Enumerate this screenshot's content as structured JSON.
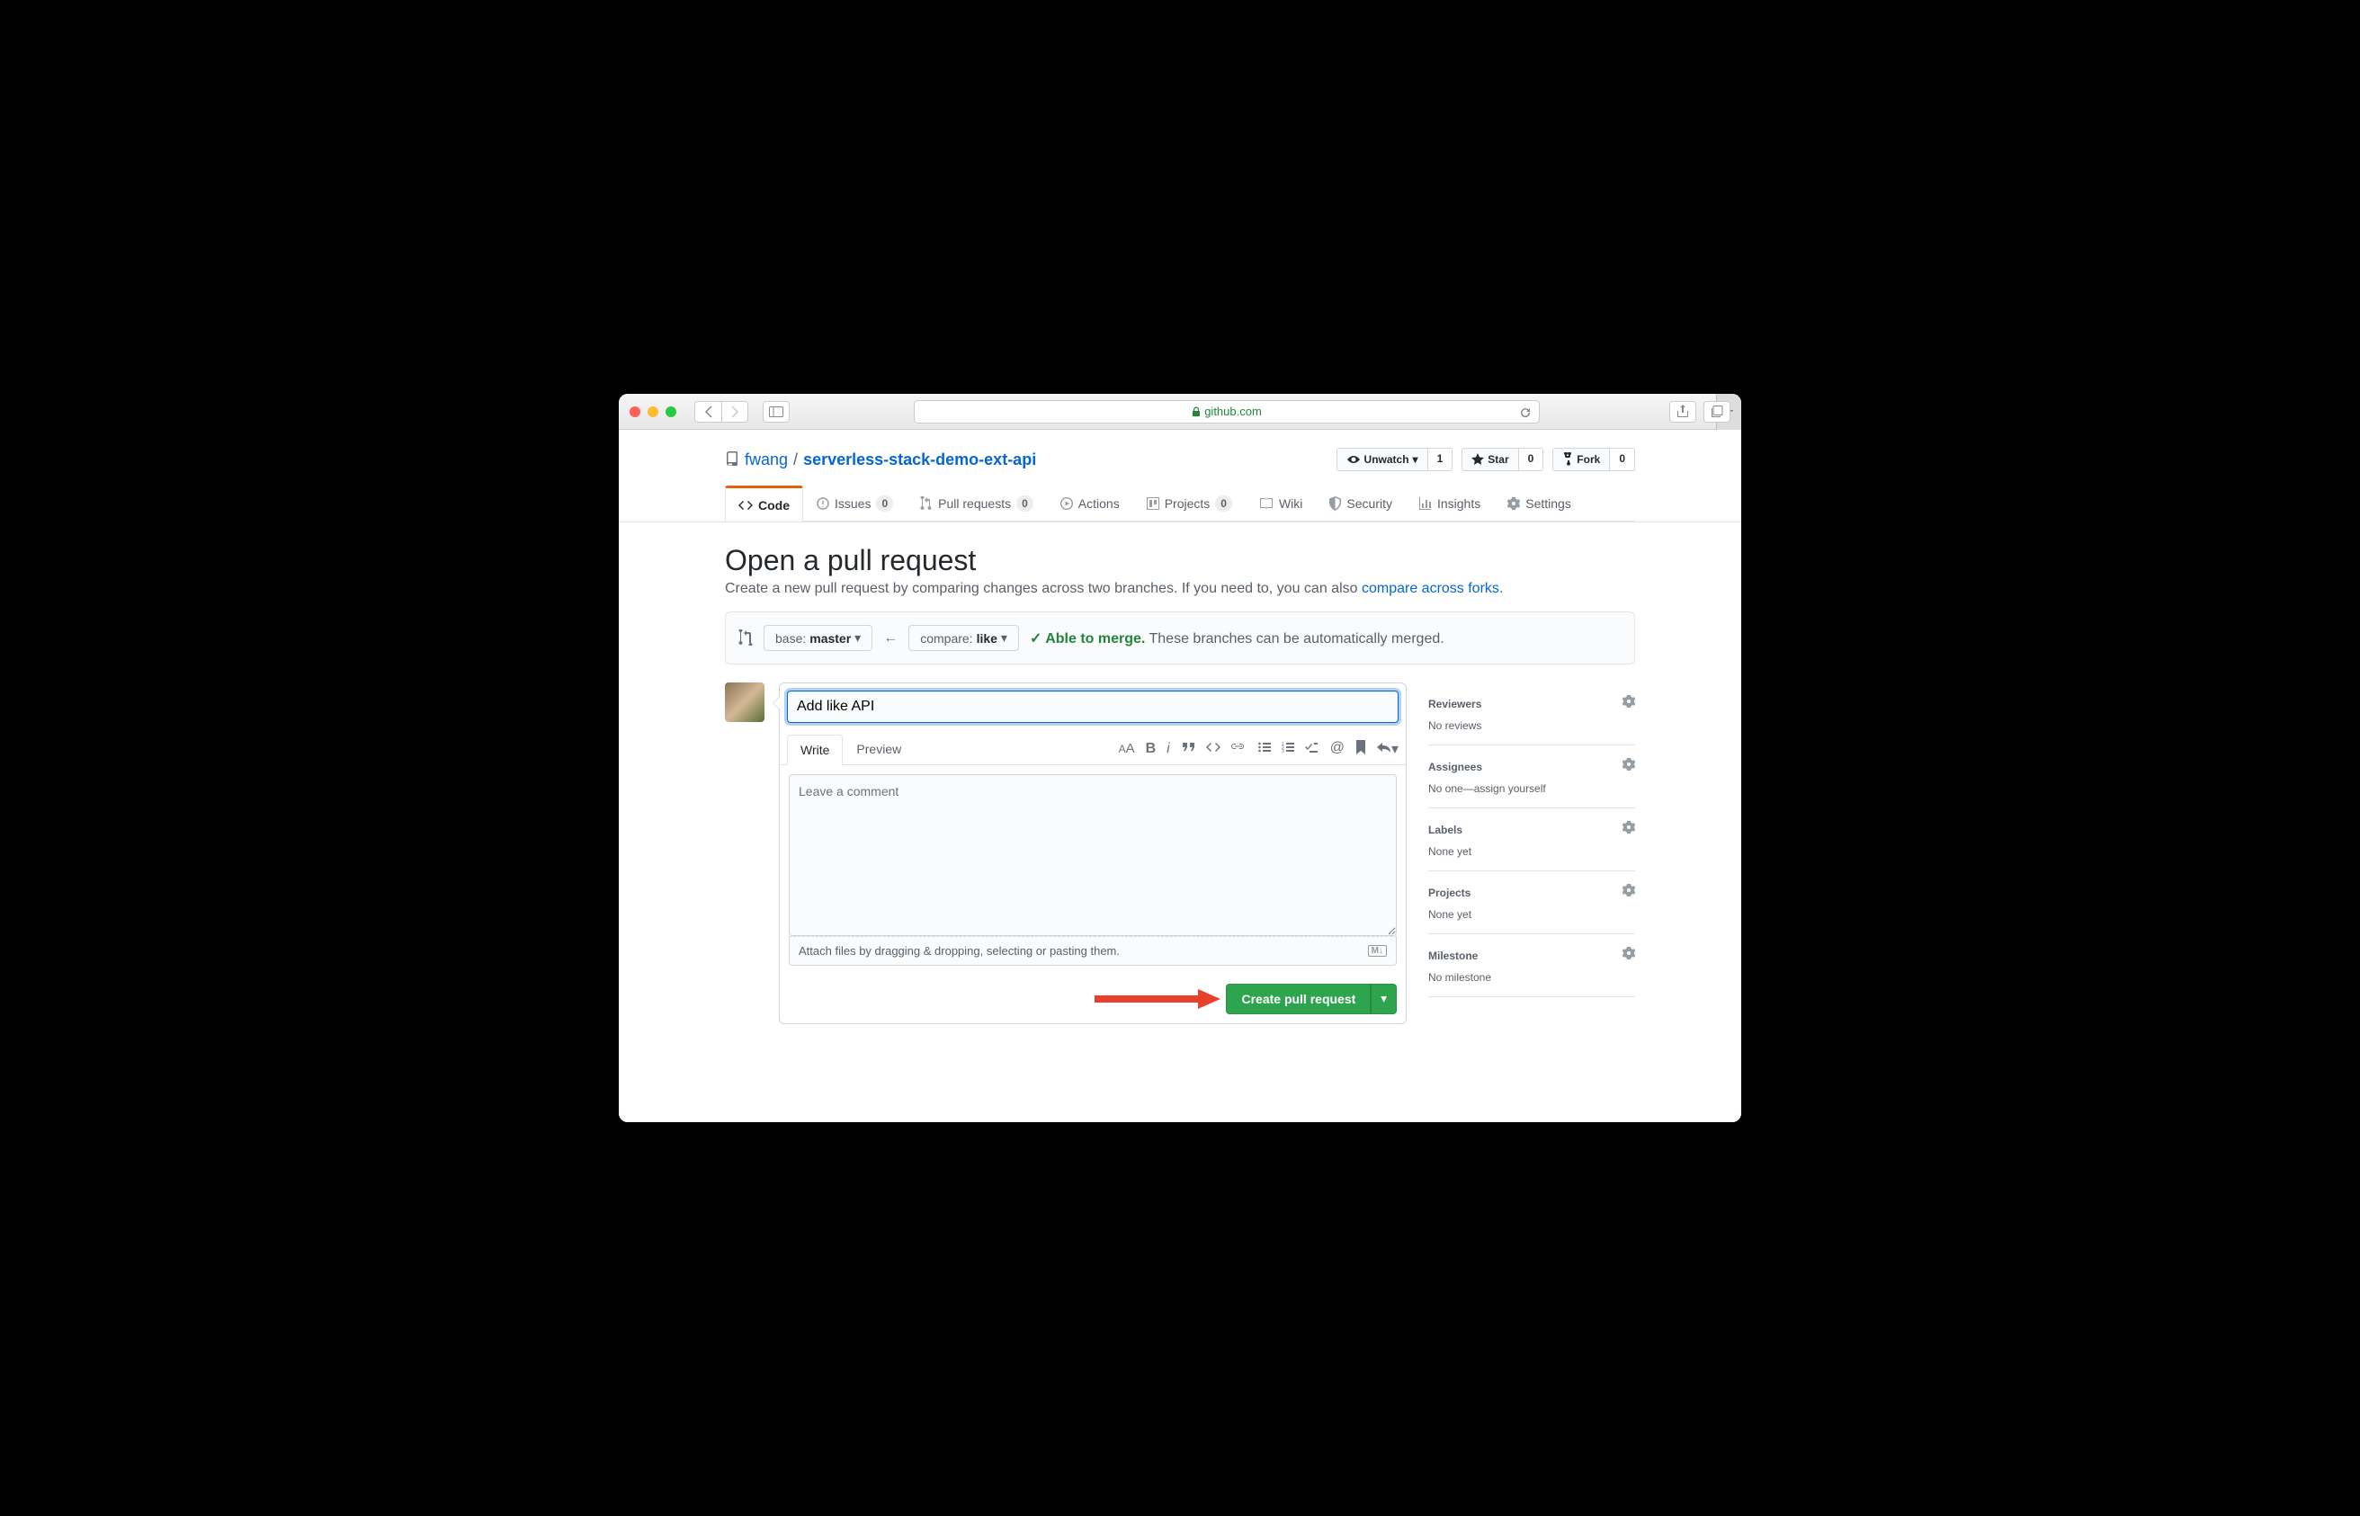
{
  "browser": {
    "url_domain": "github.com"
  },
  "repo": {
    "owner": "fwang",
    "separator": "/",
    "name": "serverless-stack-demo-ext-api",
    "actions": {
      "unwatch": {
        "label": "Unwatch",
        "count": "1"
      },
      "star": {
        "label": "Star",
        "count": "0"
      },
      "fork": {
        "label": "Fork",
        "count": "0"
      }
    }
  },
  "tabs": {
    "code": "Code",
    "issues": {
      "label": "Issues",
      "count": "0"
    },
    "pulls": {
      "label": "Pull requests",
      "count": "0"
    },
    "actions": "Actions",
    "projects": {
      "label": "Projects",
      "count": "0"
    },
    "wiki": "Wiki",
    "security": "Security",
    "insights": "Insights",
    "settings": "Settings"
  },
  "page": {
    "title": "Open a pull request",
    "desc_1": "Create a new pull request by comparing changes across two branches. If you need to, you can also ",
    "desc_link": "compare across forks",
    "desc_2": "."
  },
  "compare": {
    "base_prefix": "base: ",
    "base_branch": "master",
    "compare_prefix": "compare: ",
    "compare_branch": "like",
    "merge_check": "✓ Able to merge.",
    "merge_text": "These branches can be automatically merged."
  },
  "form": {
    "title_value": "Add like API",
    "tab_write": "Write",
    "tab_preview": "Preview",
    "placeholder": "Leave a comment",
    "attach_hint": "Attach files by dragging & dropping, selecting or pasting them.",
    "md_badge": "M↓",
    "submit": "Create pull request"
  },
  "sidebar": {
    "reviewers": {
      "title": "Reviewers",
      "content": "No reviews"
    },
    "assignees": {
      "title": "Assignees",
      "content": "No one—assign yourself"
    },
    "labels": {
      "title": "Labels",
      "content": "None yet"
    },
    "projects": {
      "title": "Projects",
      "content": "None yet"
    },
    "milestone": {
      "title": "Milestone",
      "content": "No milestone"
    }
  }
}
